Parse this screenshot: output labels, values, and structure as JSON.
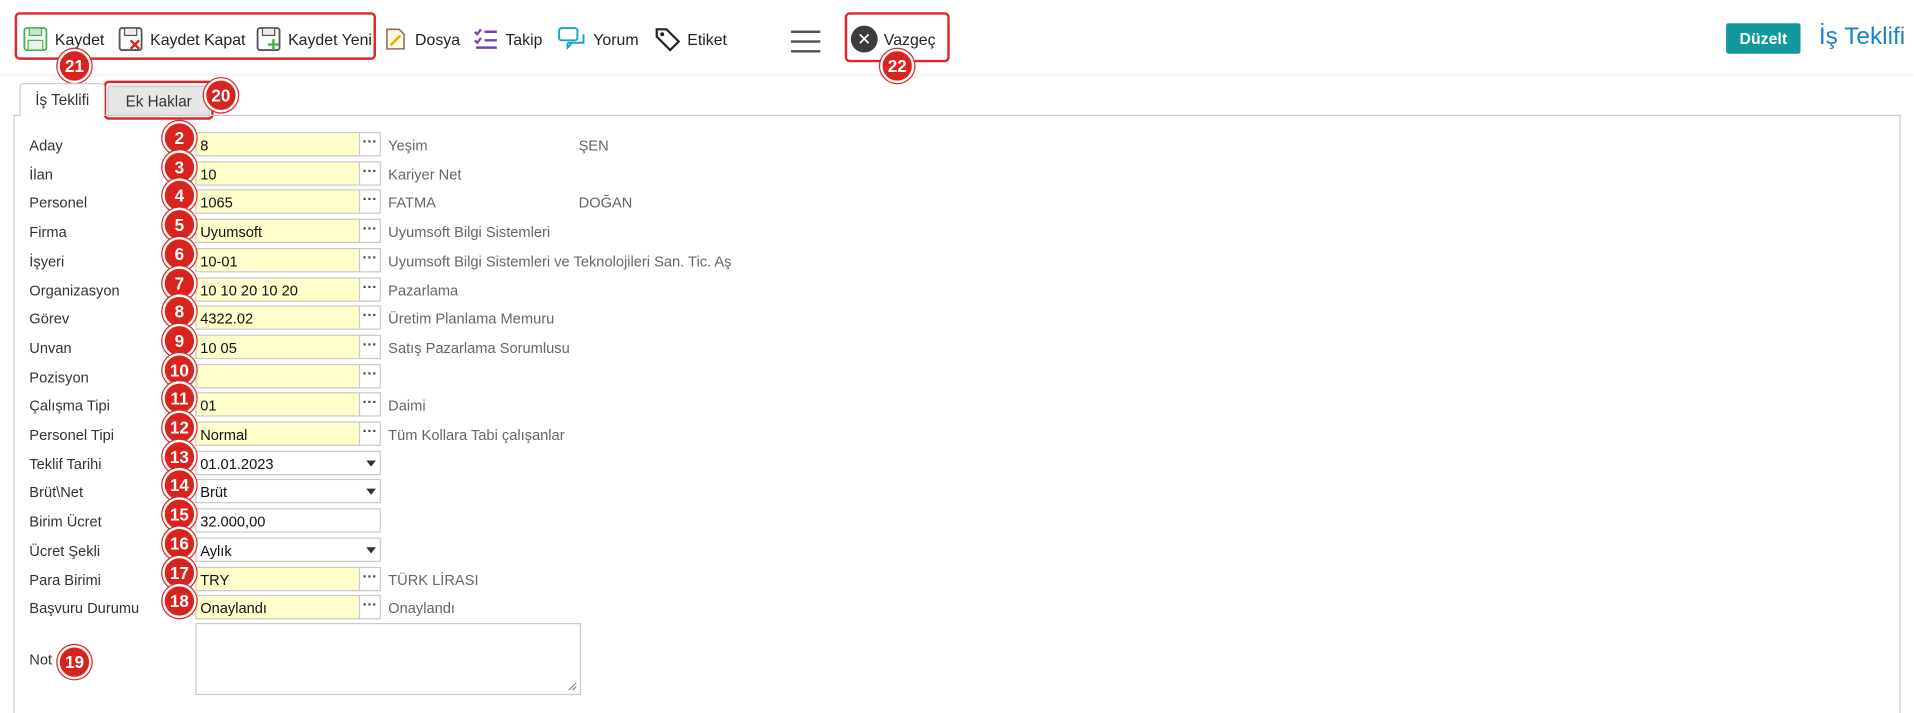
{
  "toolbar": {
    "kaydet": "Kaydet",
    "kaydet_kapat": "Kaydet Kapat",
    "kaydet_yeni": "Kaydet Yeni",
    "dosya": "Dosya",
    "takip": "Takip",
    "yorum": "Yorum",
    "etiket": "Etiket",
    "vazgec": "Vazgeç",
    "duzelt": "Düzelt",
    "page_title": "İş Teklifi"
  },
  "badges": {
    "save_group": "21",
    "cancel": "22",
    "ek_haklar_tab": "20",
    "not_field": "19"
  },
  "tabs": [
    {
      "label": "İş Teklifi",
      "active": true
    },
    {
      "label": "Ek Haklar",
      "active": false
    }
  ],
  "fields": [
    {
      "label": "Aday",
      "value": "8",
      "desc": "Yeşim",
      "desc2": "ŞEN",
      "badge": "2"
    },
    {
      "label": "İlan",
      "value": "10",
      "desc": "Kariyer Net",
      "badge": "3"
    },
    {
      "label": "Personel",
      "value": "1065",
      "desc": "FATMA",
      "desc2": "DOĞAN",
      "badge": "4"
    },
    {
      "label": "Firma",
      "value": "Uyumsoft",
      "desc": "Uyumsoft Bilgi Sistemleri",
      "badge": "5"
    },
    {
      "label": "İşyeri",
      "value": "10-01",
      "desc": "Uyumsoft Bilgi Sistemleri ve Teknolojileri San. Tic. Aş",
      "badge": "6"
    },
    {
      "label": "Organizasyon",
      "value": "10 10 20 10 20",
      "desc": "Pazarlama",
      "badge": "7"
    },
    {
      "label": "Görev",
      "value": "4322.02",
      "desc": "Üretim Planlama Memuru",
      "badge": "8"
    },
    {
      "label": "Unvan",
      "value": "10 05",
      "desc": "Satış Pazarlama Sorumlusu",
      "badge": "9"
    },
    {
      "label": "Pozisyon",
      "value": "",
      "desc": "",
      "badge": "10"
    },
    {
      "label": "Çalışma Tipi",
      "value": "01",
      "desc": "Daimi",
      "badge": "11"
    },
    {
      "label": "Personel Tipi",
      "value": "Normal",
      "desc": "Tüm Kollara Tabi çalışanlar",
      "badge": "12"
    },
    {
      "label": "Teklif Tarihi",
      "value": "01.01.2023",
      "badge": "13"
    },
    {
      "label": "Brüt\\Net",
      "value": "Brüt",
      "badge": "14"
    },
    {
      "label": "Birim Ücret",
      "value": "32.000,00",
      "badge": "15"
    },
    {
      "label": "Ücret Şekli",
      "value": "Aylık",
      "badge": "16"
    },
    {
      "label": "Para Birimi",
      "value": "TRY",
      "desc": "TÜRK LİRASI",
      "badge": "17"
    },
    {
      "label": "Başvuru Durumu",
      "value": "Onaylandı",
      "desc": "Onaylandı",
      "badge": "18"
    }
  ],
  "not_label": "Not",
  "colors": {
    "accent": "#11999e",
    "title_blue": "#1a84c8",
    "highlight_red": "#e0242a",
    "badge_red": "#d9231f",
    "input_yellow": "#ffffcc"
  }
}
